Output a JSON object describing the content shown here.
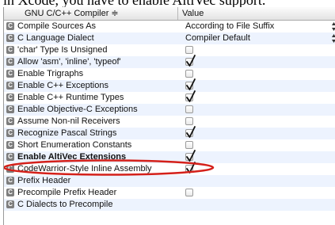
{
  "caption": "in Xcode, you have to enable AltiVec support.",
  "header": {
    "col1": "GNU C/C++ Compiler ≑",
    "col2": "Value"
  },
  "rows": [
    {
      "icon": "C",
      "name": "Compile Sources As",
      "type": "select",
      "value": "According to File Suffix"
    },
    {
      "icon": "C",
      "name": "C Language Dialect",
      "type": "select",
      "value": "Compiler Default"
    },
    {
      "icon": "C",
      "name": "'char' Type Is Unsigned",
      "type": "checkbox",
      "checked": false
    },
    {
      "icon": "C",
      "name": "Allow 'asm', 'inline', 'typeof'",
      "type": "checkbox",
      "checked": true
    },
    {
      "icon": "C",
      "name": "Enable Trigraphs",
      "type": "checkbox",
      "checked": false
    },
    {
      "icon": "C",
      "name": "Enable C++ Exceptions",
      "type": "checkbox",
      "checked": true
    },
    {
      "icon": "C",
      "name": "Enable C++ Runtime Types",
      "type": "checkbox",
      "checked": true
    },
    {
      "icon": "C",
      "name": "Enable Objective-C Exceptions",
      "type": "checkbox",
      "checked": false
    },
    {
      "icon": "C",
      "name": "Assume Non-nil Receivers",
      "type": "checkbox",
      "checked": false
    },
    {
      "icon": "C",
      "name": "Recognize Pascal Strings",
      "type": "checkbox",
      "checked": true
    },
    {
      "icon": "C",
      "name": "Short Enumeration Constants",
      "type": "checkbox",
      "checked": false
    },
    {
      "icon": "C",
      "name": "Enable AltiVec Extensions",
      "type": "checkbox",
      "checked": true,
      "bold": true
    },
    {
      "icon": "C",
      "name": "CodeWarrior-Style Inline Assembly",
      "type": "checkbox",
      "checked": true
    },
    {
      "icon": "C",
      "name": "Prefix Header",
      "type": "text",
      "value": ""
    },
    {
      "icon": "C",
      "name": "Precompile Prefix Header",
      "type": "checkbox",
      "checked": false
    },
    {
      "icon": "C",
      "name": "C Dialects to Precompile",
      "type": "text",
      "value": ""
    }
  ],
  "colors": {
    "alt_row": "#edf3fe",
    "category_icon": "#7d7d7d",
    "highlight_ellipse": "#d4201a"
  }
}
